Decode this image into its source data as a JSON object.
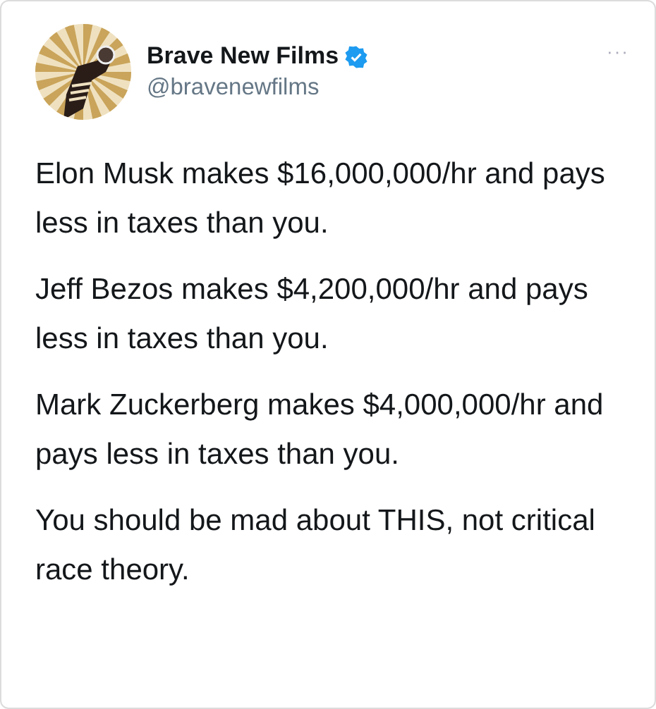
{
  "tweet": {
    "author": {
      "name": "Brave New Films",
      "verified": true,
      "handle": "@bravenewfilms"
    },
    "more_menu": "···",
    "paragraphs": [
      "Elon Musk makes $16,000,000/hr and pays less in taxes than you.",
      "Jeff Bezos makes $4,200,000/hr and pays less in taxes than you.",
      "Mark Zuckerberg makes $4,000,000/hr and pays less in taxes than you.",
      "You should be mad about THIS, not critical race theory."
    ]
  }
}
